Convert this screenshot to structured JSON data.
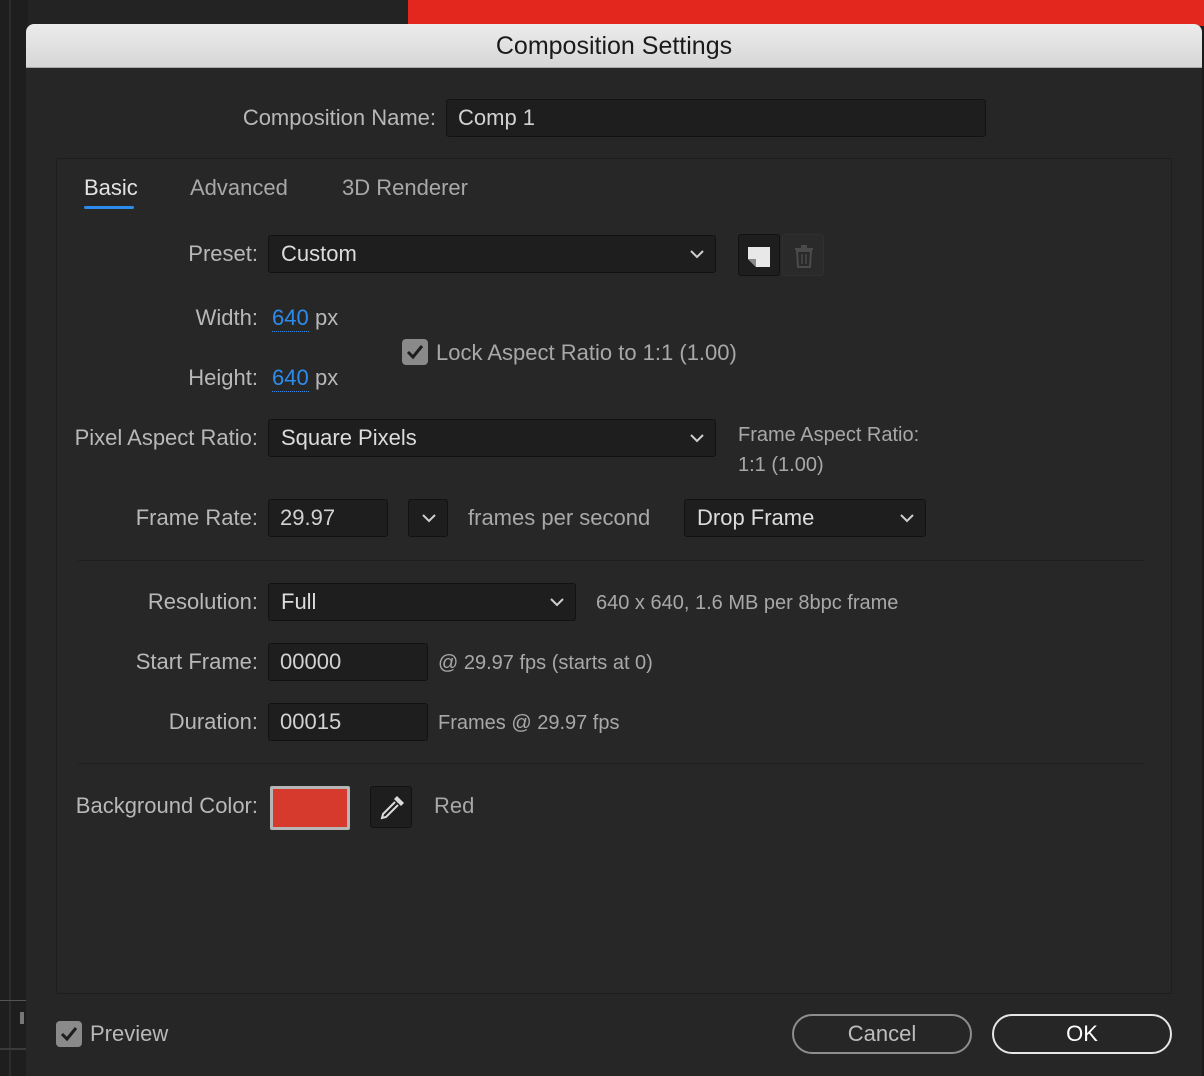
{
  "dialog": {
    "title": "Composition Settings",
    "composition_name_label": "Composition Name:",
    "composition_name_value": "Comp 1"
  },
  "tabs": [
    {
      "label": "Basic",
      "active": true
    },
    {
      "label": "Advanced",
      "active": false
    },
    {
      "label": "3D Renderer",
      "active": false
    }
  ],
  "basic": {
    "preset_label": "Preset:",
    "preset_value": "Custom",
    "width_label": "Width:",
    "width_value": "640",
    "height_label": "Height:",
    "height_value": "640",
    "px_unit": "px",
    "lock_aspect_label": "Lock Aspect Ratio to 1:1 (1.00)",
    "lock_aspect_checked": true,
    "pixel_aspect_label": "Pixel Aspect Ratio:",
    "pixel_aspect_value": "Square Pixels",
    "frame_aspect_label": "Frame Aspect Ratio:",
    "frame_aspect_value": "1:1 (1.00)",
    "frame_rate_label": "Frame Rate:",
    "frame_rate_value": "29.97",
    "frames_per_second_label": "frames per second",
    "drop_frame_value": "Drop Frame",
    "resolution_label": "Resolution:",
    "resolution_value": "Full",
    "resolution_info": "640 x 640, 1.6 MB per 8bpc frame",
    "start_frame_label": "Start Frame:",
    "start_frame_value": "00000",
    "start_frame_info": "@ 29.97 fps (starts at 0)",
    "duration_label": "Duration:",
    "duration_value": "00015",
    "duration_info": "Frames @ 29.97 fps",
    "background_color_label": "Background Color:",
    "background_color_name": "Red",
    "background_color_hex": "#d63a2c"
  },
  "footer": {
    "preview_label": "Preview",
    "preview_checked": true,
    "cancel_label": "Cancel",
    "ok_label": "OK"
  },
  "icons": {
    "preset_save": "save-preset-icon",
    "preset_delete": "trash-icon",
    "eyedropper": "eyedropper-icon",
    "dropdown": "chevron-down-icon",
    "checkmark": "checkmark-icon"
  },
  "colors": {
    "accent_blue": "#2d8ceb",
    "background_behind": "#e3261e"
  }
}
